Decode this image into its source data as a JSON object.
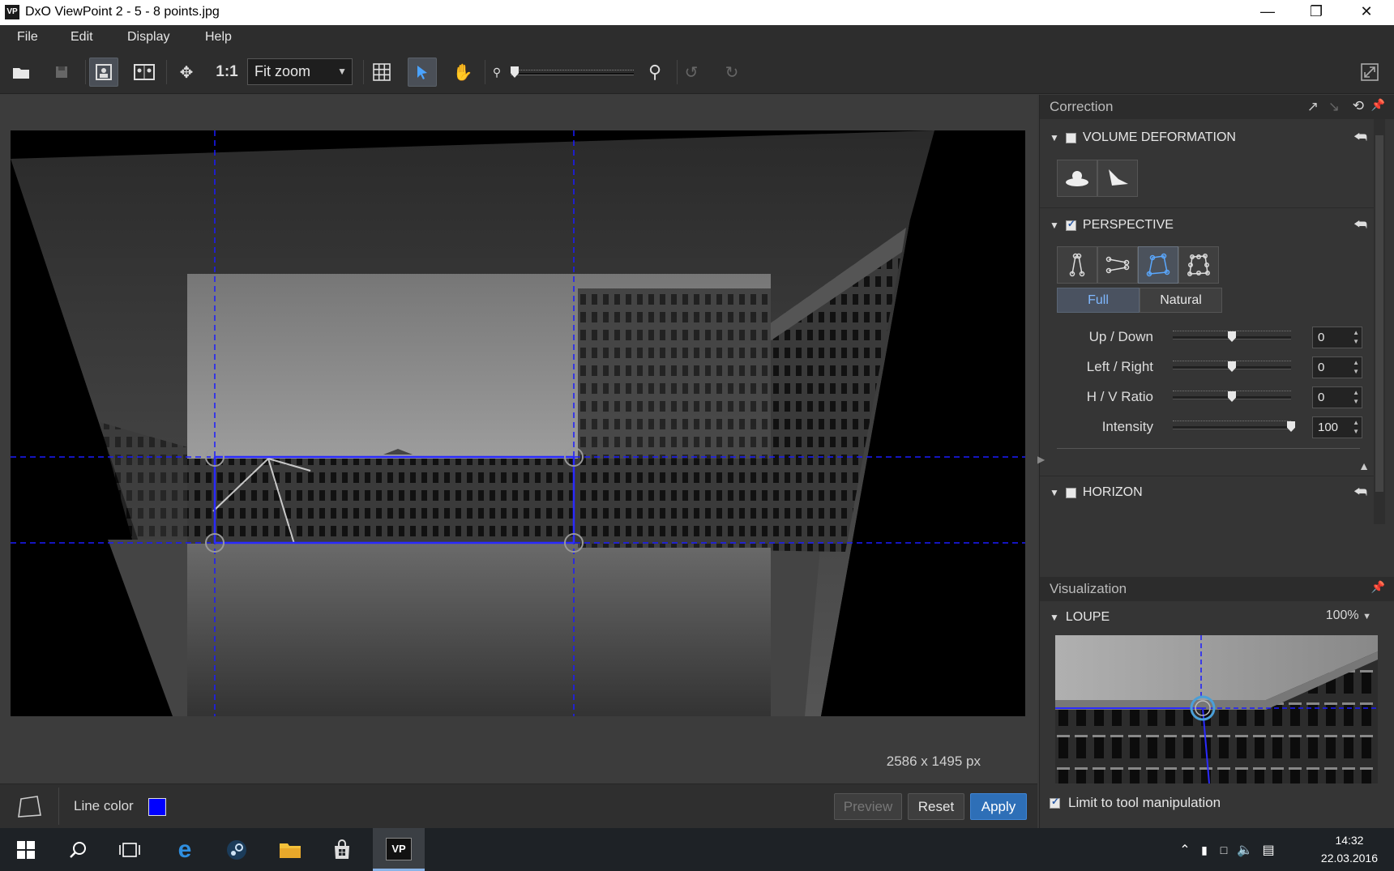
{
  "window": {
    "app_icon": "VP",
    "title": "DxO ViewPoint 2 - 5 - 8 points.jpg"
  },
  "menu": [
    "File",
    "Edit",
    "Display",
    "Help"
  ],
  "toolbar": {
    "one_to_one": "1:1",
    "zoom_value": "Fit zoom"
  },
  "canvas": {
    "dimensions": "2586 x 1495 px"
  },
  "bottom": {
    "line_color_label": "Line color",
    "line_color": "#0000ff",
    "preview": "Preview",
    "reset": "Reset",
    "apply": "Apply"
  },
  "panel": {
    "correction_title": "Correction",
    "volume_title": "VOLUME DEFORMATION",
    "perspective_title": "PERSPECTIVE",
    "mode_full": "Full",
    "mode_natural": "Natural",
    "sliders": [
      {
        "label": "Up  /  Down",
        "value": "0",
        "level": 0.5
      },
      {
        "label": "Left  /  Right",
        "value": "0",
        "level": 0.5
      },
      {
        "label": "H  /  V Ratio",
        "value": "0",
        "level": 0.5
      },
      {
        "label": "Intensity",
        "value": "100",
        "level": 1.0
      }
    ],
    "horizon_title": "HORIZON",
    "visualization_title": "Visualization",
    "loupe_title": "LOUPE",
    "loupe_zoom": "100%",
    "limit_label": "Limit to tool manipulation"
  },
  "taskbar": {
    "time": "14:32",
    "date": "22.03.2016"
  },
  "colors": {
    "accent": "#2e6fb7",
    "guide": "#1a1aff"
  }
}
